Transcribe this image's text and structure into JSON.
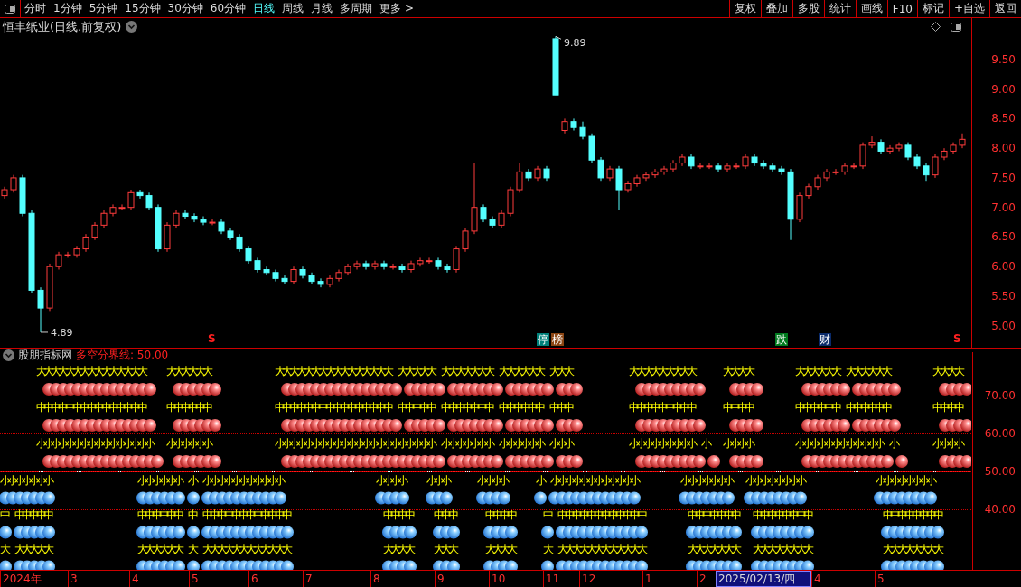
{
  "toolbar": {
    "tabs": [
      {
        "label": "分时",
        "selected": false
      },
      {
        "label": "1分钟",
        "selected": false
      },
      {
        "label": "5分钟",
        "selected": false
      },
      {
        "label": "15分钟",
        "selected": false
      },
      {
        "label": "30分钟",
        "selected": false
      },
      {
        "label": "60分钟",
        "selected": false
      },
      {
        "label": "日线",
        "selected": true
      },
      {
        "label": "周线",
        "selected": false
      },
      {
        "label": "月线",
        "selected": false
      },
      {
        "label": "多周期",
        "selected": false
      },
      {
        "label": "更多 >",
        "selected": false
      }
    ],
    "buttons": [
      "复权",
      "叠加",
      "多股",
      "统计",
      "画线",
      "F10",
      "标记",
      "+自选",
      "返回"
    ]
  },
  "chart": {
    "title": "恒丰纸业(日线.前复权)",
    "high_label": "9.89",
    "low_label": "4.89",
    "markers": [
      {
        "text": "S",
        "kind": "signal"
      },
      {
        "text": "停",
        "kind": "tag",
        "color": "#00807a"
      },
      {
        "text": "榜",
        "kind": "tag",
        "color": "#8b4513"
      },
      {
        "text": "跌",
        "kind": "tag",
        "color": "#007a1e"
      },
      {
        "text": "财",
        "kind": "tag",
        "color": "#0a2a6a"
      },
      {
        "text": "S",
        "kind": "signal"
      }
    ],
    "chart_data": {
      "type": "candlestick",
      "ylim": [
        4.63,
        9.91
      ],
      "yticks": [
        {
          "value": 9.5,
          "label": "9.50"
        },
        {
          "value": 9.0,
          "label": "9.00"
        },
        {
          "value": 8.5,
          "label": "8.50"
        },
        {
          "value": 8.0,
          "label": "8.00"
        },
        {
          "value": 7.5,
          "label": "7.50"
        },
        {
          "value": 7.0,
          "label": "7.00"
        },
        {
          "value": 6.5,
          "label": "6.50"
        },
        {
          "value": 6.0,
          "label": "6.00"
        },
        {
          "value": 5.5,
          "label": "5.50"
        },
        {
          "value": 5.0,
          "label": "5.00"
        }
      ],
      "ohlc": [
        [
          7.2,
          7.35,
          7.15,
          7.3
        ],
        [
          7.3,
          7.55,
          7.25,
          7.5
        ],
        [
          7.5,
          7.55,
          6.85,
          6.9
        ],
        [
          6.9,
          6.95,
          5.55,
          5.6
        ],
        [
          5.6,
          5.65,
          4.89,
          5.3
        ],
        [
          5.3,
          6.05,
          5.25,
          6.0
        ],
        [
          6.0,
          6.25,
          5.95,
          6.2
        ],
        [
          6.2,
          6.25,
          6.15,
          6.2
        ],
        [
          6.2,
          6.35,
          6.15,
          6.3
        ],
        [
          6.3,
          6.55,
          6.25,
          6.5
        ],
        [
          6.5,
          6.75,
          6.45,
          6.7
        ],
        [
          6.7,
          6.95,
          6.65,
          6.9
        ],
        [
          6.9,
          7.05,
          6.85,
          7.0
        ],
        [
          7.0,
          7.05,
          6.95,
          7.0
        ],
        [
          7.0,
          7.3,
          6.95,
          7.25
        ],
        [
          7.25,
          7.3,
          7.15,
          7.2
        ],
        [
          7.2,
          7.25,
          6.95,
          7.0
        ],
        [
          7.0,
          7.05,
          6.25,
          6.3
        ],
        [
          6.3,
          6.75,
          6.25,
          6.7
        ],
        [
          6.7,
          6.95,
          6.65,
          6.9
        ],
        [
          6.9,
          6.95,
          6.8,
          6.85
        ],
        [
          6.85,
          6.9,
          6.75,
          6.8
        ],
        [
          6.8,
          6.85,
          6.7,
          6.75
        ],
        [
          6.75,
          6.8,
          6.7,
          6.75
        ],
        [
          6.75,
          6.8,
          6.55,
          6.6
        ],
        [
          6.6,
          6.65,
          6.45,
          6.5
        ],
        [
          6.5,
          6.55,
          6.25,
          6.3
        ],
        [
          6.3,
          6.35,
          6.05,
          6.1
        ],
        [
          6.1,
          6.15,
          5.9,
          5.95
        ],
        [
          5.95,
          6.0,
          5.85,
          5.9
        ],
        [
          5.9,
          5.95,
          5.75,
          5.8
        ],
        [
          5.8,
          5.85,
          5.7,
          5.75
        ],
        [
          5.75,
          6.0,
          5.7,
          5.95
        ],
        [
          5.95,
          6.0,
          5.8,
          5.85
        ],
        [
          5.85,
          5.9,
          5.7,
          5.75
        ],
        [
          5.75,
          5.8,
          5.65,
          5.7
        ],
        [
          5.7,
          5.85,
          5.65,
          5.8
        ],
        [
          5.8,
          5.95,
          5.75,
          5.9
        ],
        [
          5.9,
          6.05,
          5.85,
          6.0
        ],
        [
          6.0,
          6.1,
          5.95,
          6.05
        ],
        [
          6.05,
          6.1,
          5.95,
          6.0
        ],
        [
          6.0,
          6.1,
          5.95,
          6.05
        ],
        [
          6.05,
          6.1,
          5.95,
          6.0
        ],
        [
          6.0,
          6.05,
          5.95,
          6.0
        ],
        [
          6.0,
          6.05,
          5.9,
          5.95
        ],
        [
          5.95,
          6.1,
          5.9,
          6.05
        ],
        [
          6.05,
          6.15,
          6.0,
          6.1
        ],
        [
          6.1,
          6.15,
          6.05,
          6.1
        ],
        [
          6.1,
          6.15,
          5.95,
          6.0
        ],
        [
          6.0,
          6.05,
          5.9,
          5.95
        ],
        [
          5.95,
          6.35,
          5.9,
          6.3
        ],
        [
          6.3,
          6.65,
          6.25,
          6.6
        ],
        [
          6.6,
          7.75,
          6.55,
          7.0
        ],
        [
          7.0,
          7.05,
          6.75,
          6.8
        ],
        [
          6.8,
          6.85,
          6.65,
          6.7
        ],
        [
          6.7,
          6.95,
          6.65,
          6.9
        ],
        [
          6.9,
          7.35,
          6.85,
          7.3
        ],
        [
          7.3,
          7.75,
          7.25,
          7.6
        ],
        [
          7.6,
          7.65,
          7.45,
          7.5
        ],
        [
          7.5,
          7.7,
          7.45,
          7.65
        ],
        [
          7.65,
          7.7,
          7.45,
          7.5
        ],
        [
          9.85,
          9.89,
          8.9,
          8.9
        ],
        [
          8.3,
          8.5,
          8.25,
          8.45
        ],
        [
          8.45,
          8.5,
          8.3,
          8.35
        ],
        [
          8.35,
          8.45,
          8.15,
          8.2
        ],
        [
          8.2,
          8.25,
          7.75,
          7.8
        ],
        [
          7.8,
          7.85,
          7.45,
          7.5
        ],
        [
          7.5,
          7.7,
          7.45,
          7.65
        ],
        [
          7.65,
          7.7,
          6.95,
          7.3
        ],
        [
          7.3,
          7.45,
          7.25,
          7.4
        ],
        [
          7.4,
          7.55,
          7.35,
          7.5
        ],
        [
          7.5,
          7.6,
          7.45,
          7.55
        ],
        [
          7.55,
          7.65,
          7.5,
          7.6
        ],
        [
          7.6,
          7.7,
          7.55,
          7.65
        ],
        [
          7.65,
          7.8,
          7.6,
          7.75
        ],
        [
          7.75,
          7.9,
          7.7,
          7.85
        ],
        [
          7.85,
          7.9,
          7.65,
          7.7
        ],
        [
          7.7,
          7.75,
          7.65,
          7.7
        ],
        [
          7.7,
          7.75,
          7.65,
          7.7
        ],
        [
          7.7,
          7.75,
          7.6,
          7.65
        ],
        [
          7.65,
          7.75,
          7.6,
          7.7
        ],
        [
          7.7,
          7.75,
          7.65,
          7.7
        ],
        [
          7.7,
          7.9,
          7.65,
          7.85
        ],
        [
          7.85,
          7.9,
          7.7,
          7.75
        ],
        [
          7.75,
          7.8,
          7.65,
          7.7
        ],
        [
          7.7,
          7.75,
          7.6,
          7.65
        ],
        [
          7.65,
          7.7,
          7.55,
          7.6
        ],
        [
          7.6,
          7.65,
          6.45,
          6.8
        ],
        [
          6.8,
          7.25,
          6.75,
          7.2
        ],
        [
          7.2,
          7.4,
          7.15,
          7.35
        ],
        [
          7.35,
          7.55,
          7.3,
          7.5
        ],
        [
          7.5,
          7.65,
          7.45,
          7.6
        ],
        [
          7.6,
          7.65,
          7.55,
          7.6
        ],
        [
          7.6,
          7.75,
          7.55,
          7.7
        ],
        [
          7.7,
          7.75,
          7.65,
          7.7
        ],
        [
          7.7,
          8.1,
          7.65,
          8.05
        ],
        [
          8.05,
          8.2,
          8.0,
          8.1
        ],
        [
          8.1,
          8.15,
          7.9,
          7.95
        ],
        [
          7.95,
          8.05,
          7.9,
          8.0
        ],
        [
          8.0,
          8.1,
          7.95,
          8.05
        ],
        [
          8.05,
          8.1,
          7.8,
          7.85
        ],
        [
          7.85,
          7.9,
          7.65,
          7.7
        ],
        [
          7.7,
          7.75,
          7.45,
          7.55
        ],
        [
          7.55,
          7.9,
          7.5,
          7.85
        ],
        [
          7.85,
          8.0,
          7.8,
          7.95
        ],
        [
          7.95,
          8.1,
          7.9,
          8.05
        ],
        [
          8.05,
          8.25,
          8.0,
          8.15
        ]
      ]
    }
  },
  "indicator": {
    "name": "股朋指标网",
    "line_label": "多空分界线: 50.00",
    "ticks": [
      "70.00",
      "60.00",
      "50.00",
      "40.00"
    ],
    "zones": [
      {
        "kind": "up",
        "rows": [
          {
            "text": "      大大大大大大大大大大大大大大大   大大大大大大         大大大大大大大大大大大大大大大大 大大大大大 大大大大大大大 大大大大大大 大大大        大大大大大大大大大    大大大大      大大大大大大 大大大大大大      大大大大"
          },
          {
            "text": "      中中中中中中中中中中中中中中中   中中中中中中         中中中中中中中中中中中中中中中中 中中中中中 中中中中中中中 中中中中中中 中中中        中中中中中中中中中    中中中中      中中中中中中 中中中中中中      中中中中"
          },
          {
            "text": "      小小小小小小小小小小小小小小小小  小小小小小小         小小小小小小小小小小小小小小小小小小小小小小 小小小小小小小 小小小小小小 小小小        小小小小小小小小小 小  小小小小      小小小小小小小小小小小小 小     小小小小"
          }
        ]
      },
      {
        "kind": "down",
        "rows": [
          {
            "text": "小小小小小小小            小小小小小小 小 小小小小小小小小小小小             小小小小   小小小    小小小小    小 小小小小小小小小小小小小      小小小小小小小  小小小小小小小小          小小小小小小小小"
          },
          {
            "text": "中 中中中中中            中中中中中中 中 中中中中中中中中中中中中             中中中中   中中中    中中中中    中 中中中中中中中中中中中中      中中中中中中中  中中中中中中中中          中中中中中中中中"
          },
          {
            "text": "大 大大大大大            大大大大大大 大 大大大大大大大大大大大大             大大大大   大大大    大大大大    大 大大大大大大大大大大大大      大大大大大大大  大大大大大大大大          大大大大大大大大"
          }
        ]
      }
    ]
  },
  "time_axis": [
    {
      "label": "2024年",
      "selected": false
    },
    {
      "label": "3",
      "selected": false
    },
    {
      "label": "4",
      "selected": false
    },
    {
      "label": "5",
      "selected": false
    },
    {
      "label": "6",
      "selected": false
    },
    {
      "label": "7",
      "selected": false
    },
    {
      "label": "8",
      "selected": false
    },
    {
      "label": "9",
      "selected": false
    },
    {
      "label": "10",
      "selected": false
    },
    {
      "label": "11",
      "selected": false
    },
    {
      "label": "12",
      "selected": false
    },
    {
      "label": "1",
      "selected": false
    },
    {
      "label": "2",
      "selected": false
    },
    {
      "label": "2025/02/13/四",
      "selected": true
    },
    {
      "label": "4",
      "selected": false
    },
    {
      "label": "5",
      "selected": false
    }
  ]
}
